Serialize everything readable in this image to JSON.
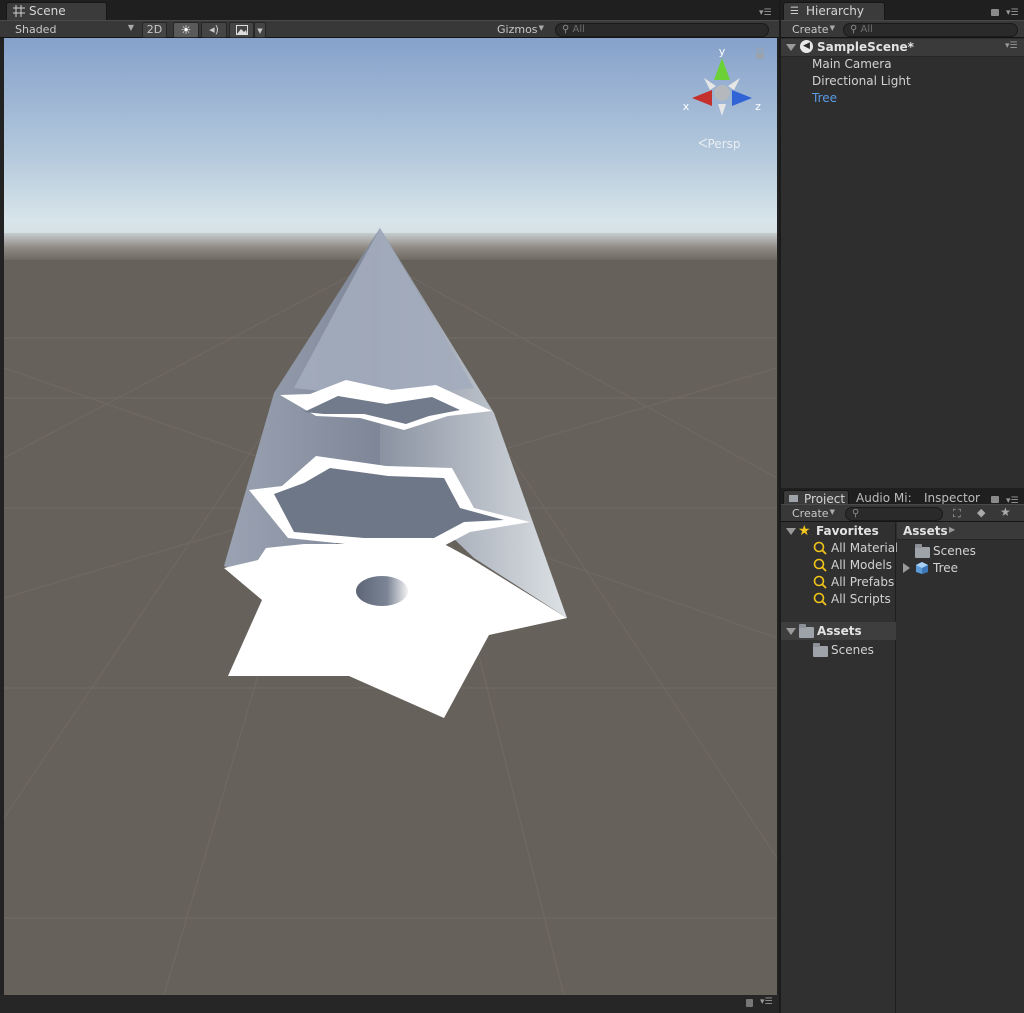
{
  "scene": {
    "tab_label": "Scene",
    "shading_mode": "Shaded",
    "mode_2d_label": "2D",
    "gizmos_label": "Gizmos",
    "search_placeholder": "All",
    "gizmo_axes": {
      "y": "y",
      "x": "x",
      "z": "z"
    },
    "projection_label": "Persp"
  },
  "hierarchy": {
    "tab_label": "Hierarchy",
    "create_label": "Create",
    "search_placeholder": "All",
    "scene_name": "SampleScene*",
    "items": [
      {
        "label": "Main Camera"
      },
      {
        "label": "Directional Light"
      },
      {
        "label": "Tree"
      }
    ]
  },
  "project": {
    "tabs": [
      {
        "label": "Project"
      },
      {
        "label": "Audio Mi:"
      },
      {
        "label": "Inspector"
      }
    ],
    "create_label": "Create",
    "favorites": {
      "label": "Favorites",
      "items": [
        {
          "label": "All Materials"
        },
        {
          "label": "All Models"
        },
        {
          "label": "All Prefabs"
        },
        {
          "label": "All Scripts"
        }
      ]
    },
    "assets_tree": {
      "label": "Assets",
      "children": [
        {
          "label": "Scenes"
        }
      ]
    },
    "assets_view": {
      "breadcrumb": "Assets",
      "items": [
        {
          "label": "Scenes"
        },
        {
          "label": "Tree"
        }
      ]
    }
  },
  "colors": {
    "selection": "#5b9ae6",
    "ground": "#67615b",
    "sky_top": "#8aa6cf",
    "horizon": "#d5e3ea"
  }
}
